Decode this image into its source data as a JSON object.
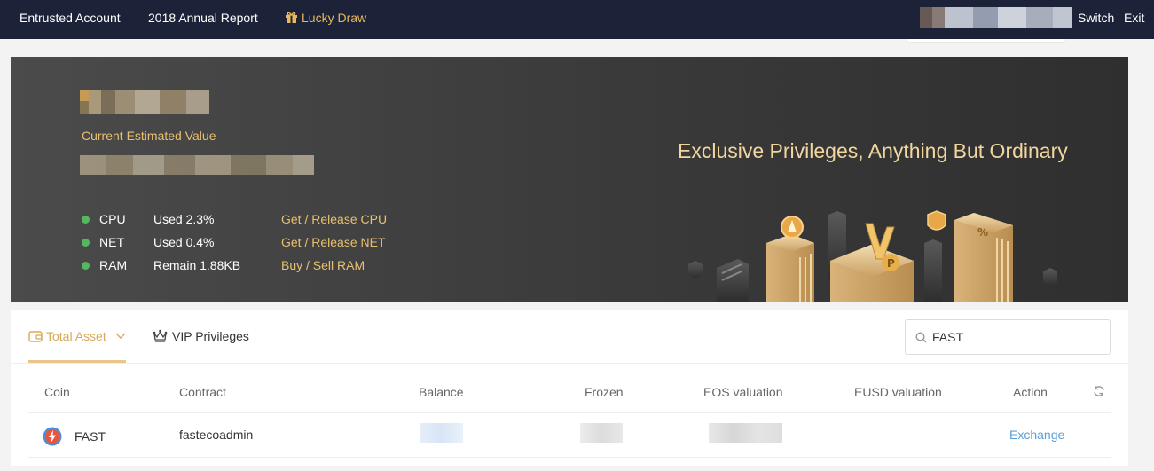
{
  "topbar": {
    "nav": [
      "Entrusted Account",
      "2018 Annual Report",
      "Lucky Draw"
    ],
    "switch_label": "Switch",
    "exit_label": "Exit",
    "lucky_color": "#e8b85a"
  },
  "banner": {
    "estimated_value_label": "Current Estimated Value",
    "resources": [
      {
        "name": "CPU",
        "value": "Used 2.3%",
        "action": "Get / Release CPU"
      },
      {
        "name": "NET",
        "value": "Used 0.4%",
        "action": "Get / Release NET"
      },
      {
        "name": "RAM",
        "value": "Remain 1.88KB",
        "action": "Buy / Sell RAM"
      }
    ],
    "slogan": "Exclusive Privileges, Anything But Ordinary",
    "status_color": "#55b85f",
    "accent_color": "#e8c070"
  },
  "assets": {
    "tabs": {
      "total": "Total Asset",
      "vip": "VIP Privileges"
    },
    "search": {
      "value": "FAST"
    },
    "columns": [
      "Coin",
      "Contract",
      "Balance",
      "Frozen",
      "EOS valuation",
      "EUSD valuation",
      "Action"
    ],
    "rows": [
      {
        "coin": "FAST",
        "contract": "fastecoadmin",
        "action": "Exchange"
      }
    ],
    "link_color": "#5a9fd9"
  }
}
